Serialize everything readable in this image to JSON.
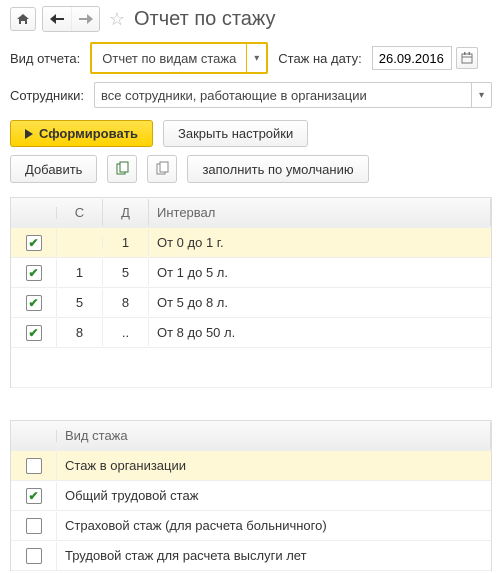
{
  "header": {
    "title": "Отчет по стажу"
  },
  "filters": {
    "report_type_label": "Вид отчета:",
    "report_type_value": "Отчет по видам стажа",
    "date_label": "Стаж на дату:",
    "date_value": "26.09.2016",
    "employees_label": "Сотрудники:",
    "employees_value": "все сотрудники, работающие в организации"
  },
  "actions": {
    "generate": "Сформировать",
    "close_settings": "Закрыть настройки",
    "add": "Добавить",
    "fill_defaults": "заполнить по умолчанию"
  },
  "intervals": {
    "headers": {
      "s": "С",
      "d": "Д",
      "interval": "Интервал"
    },
    "rows": [
      {
        "checked": true,
        "s": "",
        "d": "1",
        "label": "От 0 до 1 г."
      },
      {
        "checked": true,
        "s": "1",
        "d": "5",
        "label": "От 1 до 5 л."
      },
      {
        "checked": true,
        "s": "5",
        "d": "8",
        "label": "От 5 до 8 л."
      },
      {
        "checked": true,
        "s": "8",
        "d": "..",
        "label": "От 8 до 50 л."
      }
    ]
  },
  "stages": {
    "header": "Вид стажа",
    "rows": [
      {
        "checked": false,
        "label": "Стаж в организации"
      },
      {
        "checked": true,
        "label": "Общий трудовой стаж"
      },
      {
        "checked": false,
        "label": "Страховой стаж (для расчета больничного)"
      },
      {
        "checked": false,
        "label": "Трудовой стаж для расчета выслуги лет"
      }
    ]
  }
}
